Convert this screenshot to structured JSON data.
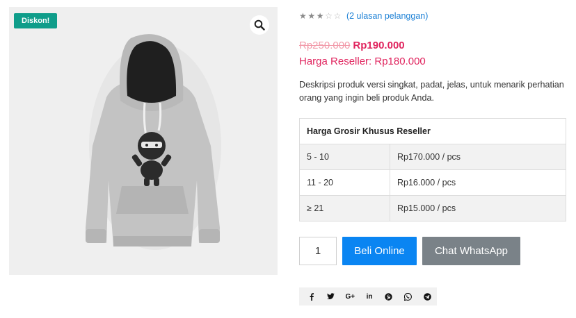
{
  "product": {
    "sale_badge": "Diskon!",
    "zoom_icon": "magnifier-icon",
    "image_subject": "hoodie"
  },
  "rating": {
    "value": 2.5,
    "max": 5,
    "review_link": "(2 ulasan pelanggan)"
  },
  "price": {
    "old": "Rp250.000",
    "new": "Rp190.000",
    "reseller": "Harga Reseller: Rp180.000"
  },
  "description": "Deskripsi produk versi singkat, padat, jelas, untuk menarik perhatian orang yang ingin beli produk Anda.",
  "wholesale": {
    "header": "Harga Grosir Khusus Reseller",
    "rows": [
      {
        "qty": "5 - 10",
        "price": "Rp170.000 / pcs"
      },
      {
        "qty": "11 - 20",
        "price": "Rp16.000 / pcs"
      },
      {
        "qty": "≥ 21",
        "price": "Rp15.000 / pcs"
      }
    ]
  },
  "cart": {
    "quantity": "1",
    "buy_label": "Beli Online",
    "whatsapp_label": "Chat WhatsApp"
  },
  "share": {
    "icons": [
      "facebook-icon",
      "twitter-icon",
      "google-plus-icon",
      "linkedin-icon",
      "pinterest-icon",
      "whatsapp-icon",
      "telegram-icon"
    ],
    "labels": [
      "f",
      "",
      "G+",
      "in",
      "",
      "",
      ""
    ]
  },
  "colors": {
    "badge": "#0f9d8a",
    "price_accent": "#e0245e",
    "buy_button": "#0a85f2",
    "whatsapp_button": "#7a8288",
    "link": "#1f82d6"
  }
}
